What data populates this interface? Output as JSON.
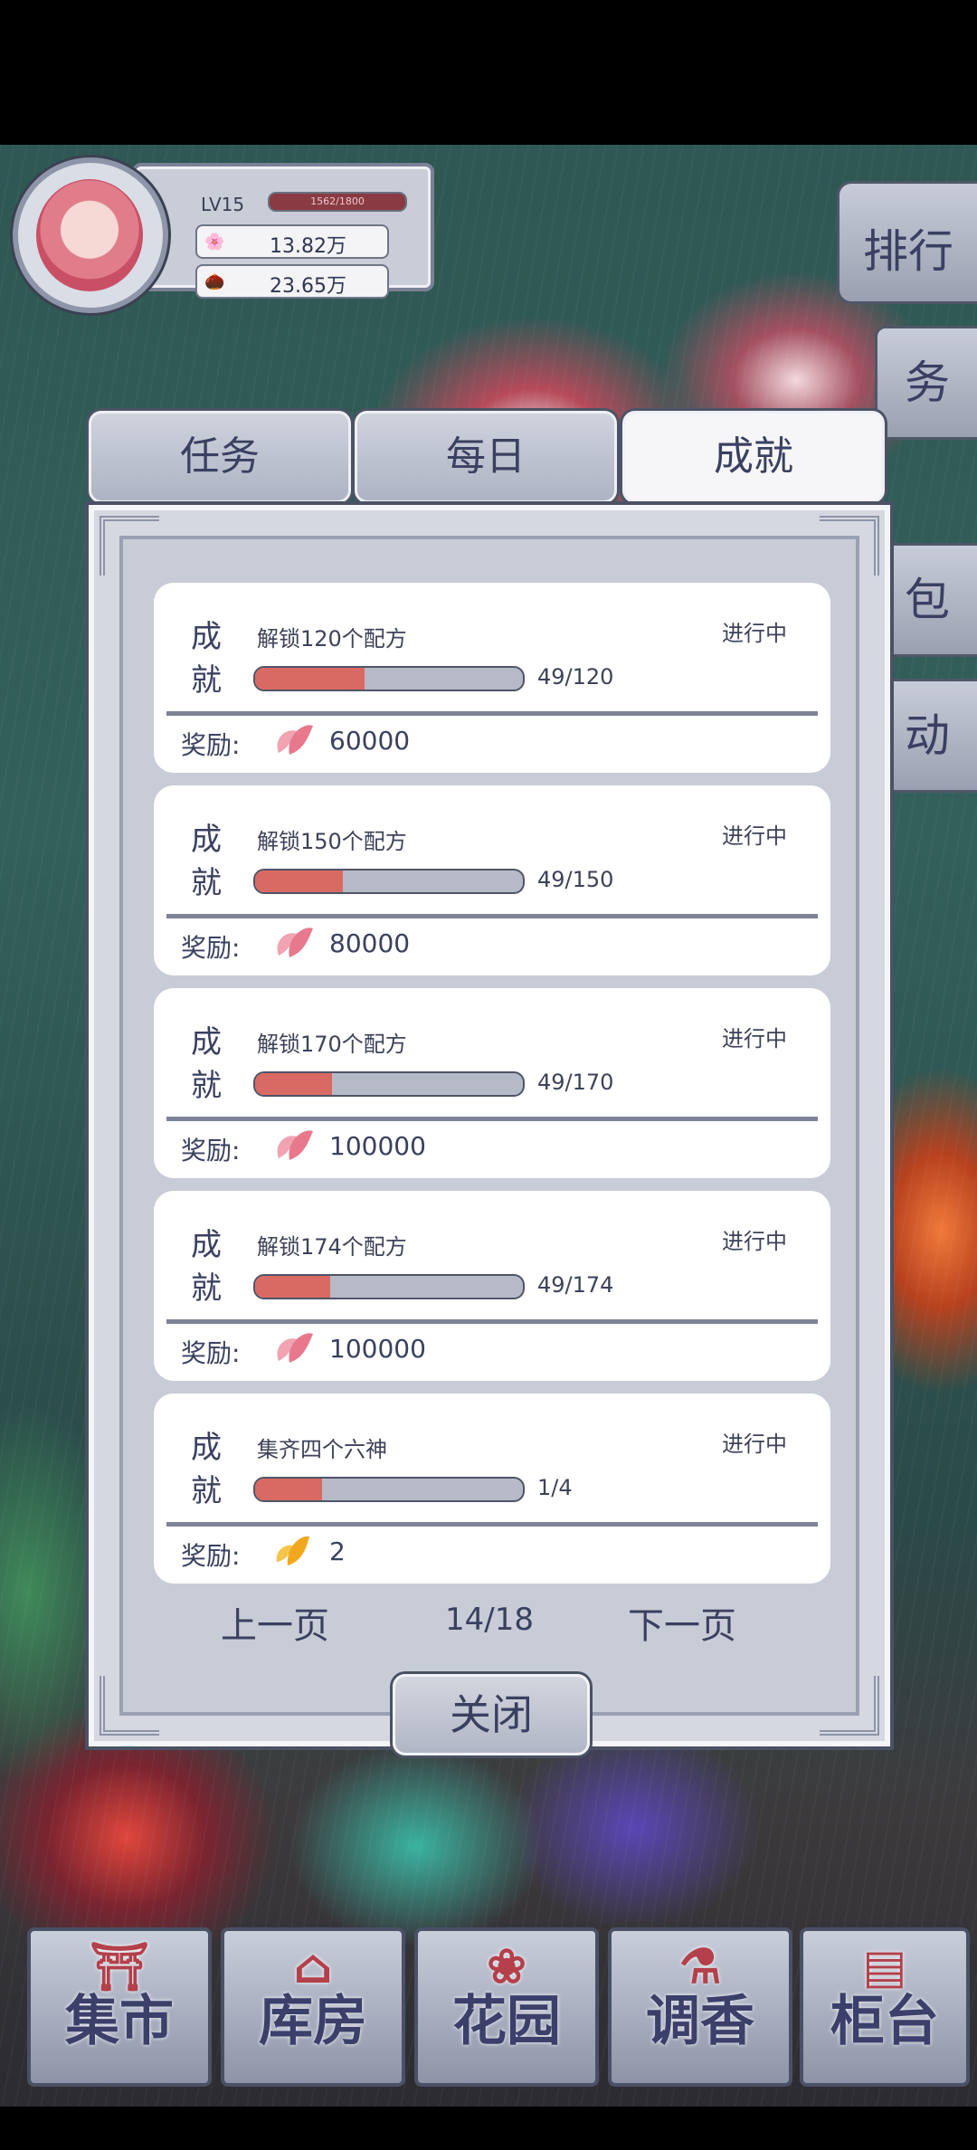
{
  "player": {
    "level": "LV15",
    "xp_text": "1562/1800",
    "petals": "13.82万",
    "seeds": "23.65万"
  },
  "side_menu": {
    "rank": "排行",
    "tasks": "务",
    "bag": "包",
    "events": "动"
  },
  "tabs": {
    "task": "任务",
    "daily": "每日",
    "achievement": "成就"
  },
  "achievements": [
    {
      "type": "成就",
      "title": "解锁120个配方",
      "status": "进行中",
      "progress": "49/120",
      "fraction": 0.408,
      "reward_label": "奖励:",
      "reward_icon": "petal-icon",
      "reward": "60000"
    },
    {
      "type": "成就",
      "title": "解锁150个配方",
      "status": "进行中",
      "progress": "49/150",
      "fraction": 0.327,
      "reward_label": "奖励:",
      "reward_icon": "petal-icon",
      "reward": "80000"
    },
    {
      "type": "成就",
      "title": "解锁170个配方",
      "status": "进行中",
      "progress": "49/170",
      "fraction": 0.288,
      "reward_label": "奖励:",
      "reward_icon": "petal-icon",
      "reward": "100000"
    },
    {
      "type": "成就",
      "title": "解锁174个配方",
      "status": "进行中",
      "progress": "49/174",
      "fraction": 0.282,
      "reward_label": "奖励:",
      "reward_icon": "petal-icon",
      "reward": "100000"
    },
    {
      "type": "成就",
      "title": "集齐四个六神",
      "status": "进行中",
      "progress": "1/4",
      "fraction": 0.25,
      "reward_label": "奖励:",
      "reward_icon": "gold-leaf-icon",
      "reward": "2"
    }
  ],
  "pager": {
    "prev": "上一页",
    "page": "14/18",
    "next": "下一页"
  },
  "close": "关闭",
  "bottom_nav": [
    {
      "label": "集市",
      "icon": "market-gate-icon"
    },
    {
      "label": "库房",
      "icon": "warehouse-icon"
    },
    {
      "label": "花园",
      "icon": "rose-icon"
    },
    {
      "label": "调香",
      "icon": "perfume-bottle-icon"
    },
    {
      "label": "柜台",
      "icon": "counter-icon"
    }
  ],
  "colors": {
    "progress_fill": "#d86a63",
    "panel_bg": "#d5d8e1",
    "text": "#3a4060"
  }
}
